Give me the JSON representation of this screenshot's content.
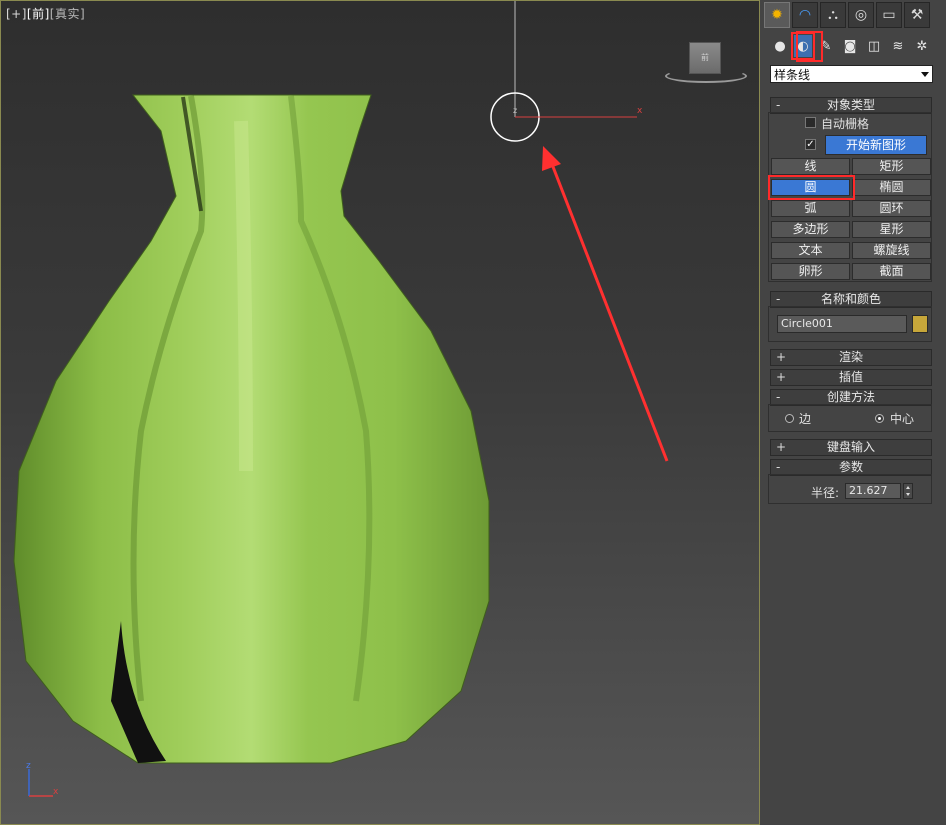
{
  "viewport": {
    "label_parts": [
      "[+]",
      "[前]",
      "[真实]"
    ],
    "viewcube_text": "前",
    "axis": {
      "z": "z",
      "x": "x"
    },
    "gizmo": {
      "z": "z",
      "x": "x"
    }
  },
  "colors": {
    "vase_green": "#8ec04a",
    "highlight_red": "#ff2a2a",
    "selected_blue": "#3a78d4",
    "object_color": "#c7a73a"
  },
  "command_panel": {
    "tabs": [
      {
        "icon": "create-icon",
        "glyph": "✹"
      },
      {
        "icon": "modify-icon",
        "glyph": "◠"
      },
      {
        "icon": "hierarchy-icon",
        "glyph": "⛬"
      },
      {
        "icon": "motion-icon",
        "glyph": "◎"
      },
      {
        "icon": "display-icon",
        "glyph": "▭"
      },
      {
        "icon": "utilities-icon",
        "glyph": "⚒"
      }
    ],
    "subcategories": [
      {
        "icon": "geometry-icon",
        "glyph": "●"
      },
      {
        "icon": "shapes-icon",
        "glyph": "◐"
      },
      {
        "icon": "lights-icon",
        "glyph": "✎"
      },
      {
        "icon": "cameras-icon",
        "glyph": "◙"
      },
      {
        "icon": "helpers-icon",
        "glyph": "◫"
      },
      {
        "icon": "spacewarps-icon",
        "glyph": "≋"
      },
      {
        "icon": "systems-icon",
        "glyph": "✲"
      }
    ],
    "category_dropdown": "样条线",
    "object_type": {
      "title": "对象类型",
      "autogrid_label": "自动栅格",
      "start_new_shape_checked": "✓",
      "start_new_shape_label": "开始新图形",
      "buttons": [
        [
          "线",
          "矩形"
        ],
        [
          "圆",
          "椭圆"
        ],
        [
          "弧",
          "圆环"
        ],
        [
          "多边形",
          "星形"
        ],
        [
          "文本",
          "螺旋线"
        ],
        [
          "卵形",
          "截面"
        ]
      ],
      "selected": "圆"
    },
    "name_color": {
      "title": "名称和颜色",
      "name": "Circle001"
    },
    "rendering": {
      "sign": "+",
      "title": "渲染"
    },
    "interpolation": {
      "sign": "+",
      "title": "插值"
    },
    "creation_method": {
      "sign": "-",
      "title": "创建方法",
      "edge_label": "边",
      "center_label": "中心",
      "selected": "中心"
    },
    "keyboard_entry": {
      "sign": "+",
      "title": "键盘输入"
    },
    "parameters": {
      "sign": "-",
      "title": "参数",
      "radius_label": "半径:",
      "radius_value": "21.627"
    },
    "object_type_sign": "-",
    "name_color_sign": "-"
  }
}
